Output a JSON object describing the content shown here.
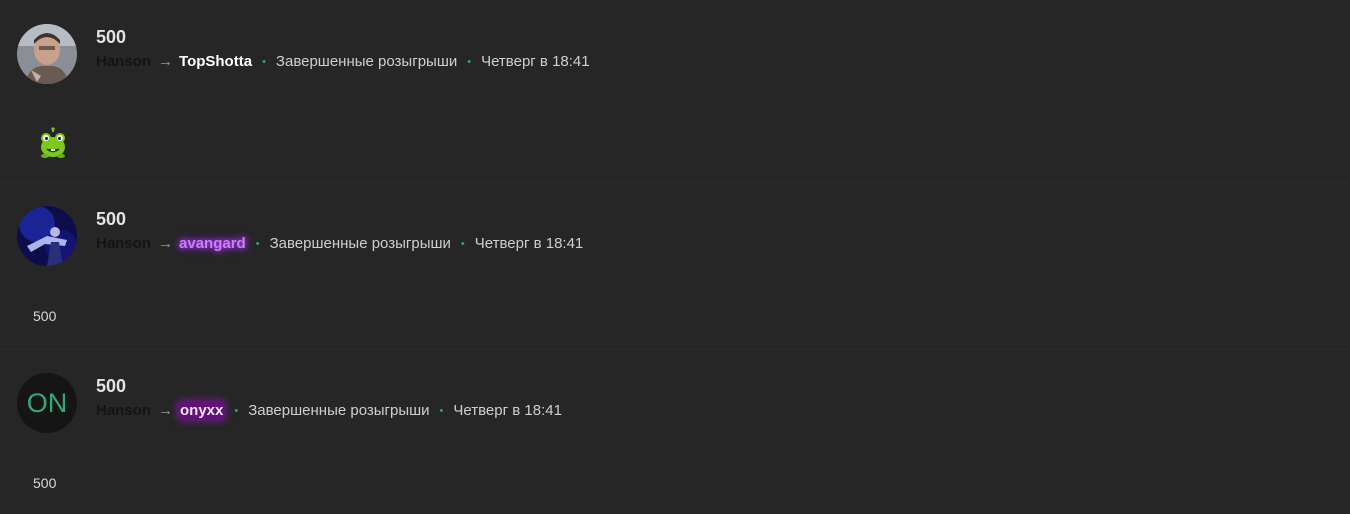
{
  "entries": [
    {
      "amount": "500",
      "sender": "Hanson",
      "arrow": "→",
      "recipient": "TopShotta",
      "category": "Завершенные розыгрыши",
      "time": "Четверг в 18:41",
      "sticker": "om-nom-frog-sticker"
    },
    {
      "amount": "500",
      "sender": "Hanson",
      "arrow": "→",
      "recipient": "avangard",
      "category": "Завершенные розыгрыши",
      "time": "Четверг в 18:41",
      "message": "500"
    },
    {
      "amount": "500",
      "sender": "Hanson",
      "arrow": "→",
      "recipient": "onyxx",
      "category": "Завершенные розыгрыши",
      "time": "Четверг в 18:41",
      "avatar_initials": "ON",
      "message": "500"
    }
  ],
  "separator": "•",
  "colors": {
    "background": "#262626",
    "dot": "#2ea86b",
    "avangard": "#cf7dff",
    "onyxx_bg": "#9600be",
    "on_avatar_text": "#35a876"
  }
}
